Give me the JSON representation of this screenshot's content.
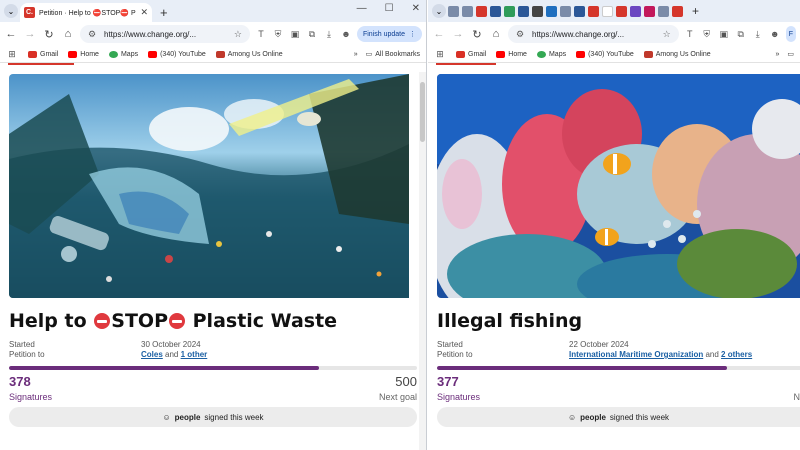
{
  "left": {
    "tab_title": "Petition · Help to ⛔STOP⛔ Pl",
    "url": "https://www.change.org/...",
    "finish_update": "Finish update",
    "bookmarks": [
      {
        "label": "Gmail",
        "color": "#d93025"
      },
      {
        "label": "Home",
        "color": "#ff0000"
      },
      {
        "label": "Maps",
        "color": "#34a853"
      },
      {
        "label": "(340) YouTube",
        "color": "#ff0000"
      },
      {
        "label": "Among Us Online",
        "color": "#c0392b"
      }
    ],
    "all_bookmarks": "All Bookmarks",
    "title_prefix": "Help to ",
    "title_mid": "STOP",
    "title_suffix": " Plastic Waste",
    "started_label": "Started",
    "started_value": "30 October 2024",
    "petition_to_label": "Petition to",
    "petition_to_1": "Coles",
    "petition_to_and": " and ",
    "petition_to_2": "1 other",
    "progress_fraction": 0.76,
    "signatures": "378",
    "goal": "500",
    "signatures_label": "Signatures",
    "goal_label": "Next goal",
    "week_bold": "people",
    "week_rest": "signed this week"
  },
  "right": {
    "url": "https://www.change.org/...",
    "bookmarks": [
      {
        "label": "Gmail",
        "color": "#d93025"
      },
      {
        "label": "Home",
        "color": "#ff0000"
      },
      {
        "label": "Maps",
        "color": "#34a853"
      },
      {
        "label": "(340) YouTube",
        "color": "#ff0000"
      },
      {
        "label": "Among Us Online",
        "color": "#c0392b"
      }
    ],
    "title": "Illegal fishing",
    "started_label": "Started",
    "started_value": "22 October 2024",
    "petition_to_label": "Petition to",
    "petition_to_1": "International Maritime Organization",
    "petition_to_and": " and ",
    "petition_to_2": "2 others",
    "progress_fraction": 0.8,
    "signatures": "377",
    "signatures_label": "Signatures",
    "goal_label": "N",
    "week_bold": "people",
    "week_rest": "signed this week"
  },
  "colors": {
    "accent": "#6b2d7b",
    "link": "#1a5fa3",
    "tabstrip": "#e8eef7"
  }
}
